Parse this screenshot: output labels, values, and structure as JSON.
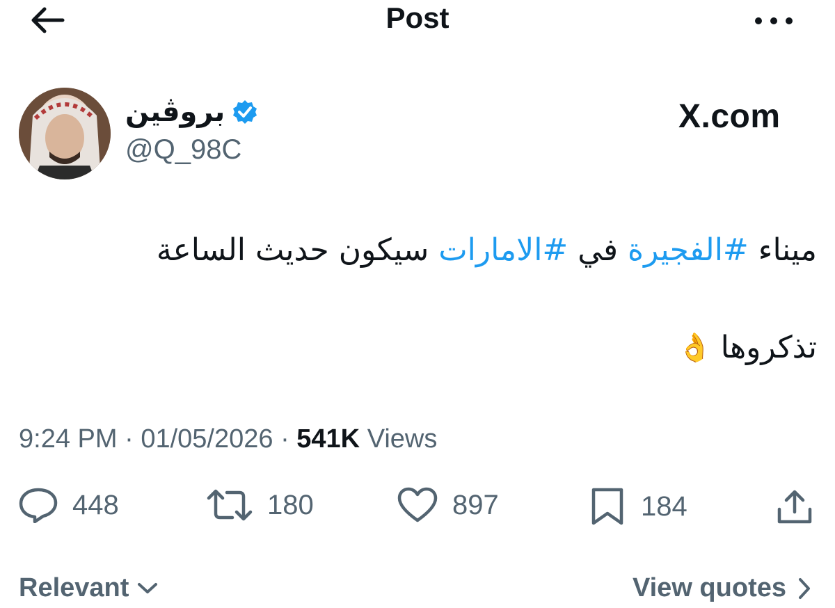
{
  "header": {
    "title": "Post",
    "back_icon": "arrow-left-icon",
    "more_icon": "more-horizontal-icon"
  },
  "author": {
    "name": "بروڤين",
    "handle": "@Q_98C",
    "verified_icon": "verified-badge-icon",
    "verified_color": "#1d9bf0"
  },
  "watermark": {
    "text": "X.com"
  },
  "post": {
    "line1": {
      "w1": "ميناء",
      "tag1": "#الفجيرة",
      "w2": "في",
      "tag2": "#الامارات",
      "w3": "سيكون حديث الساعة"
    },
    "line2": {
      "text": "تذكروها",
      "emoji": "👌"
    },
    "hashtag_color": "#1d9bf0"
  },
  "meta": {
    "time": "9:24 PM",
    "date": "01/05/2026",
    "views_count": "541K",
    "views_label": "Views"
  },
  "actions": {
    "replies": "448",
    "reposts": "180",
    "likes": "897",
    "bookmarks": "184"
  },
  "footer": {
    "sort_label": "Relevant",
    "quotes_label": "View quotes"
  }
}
